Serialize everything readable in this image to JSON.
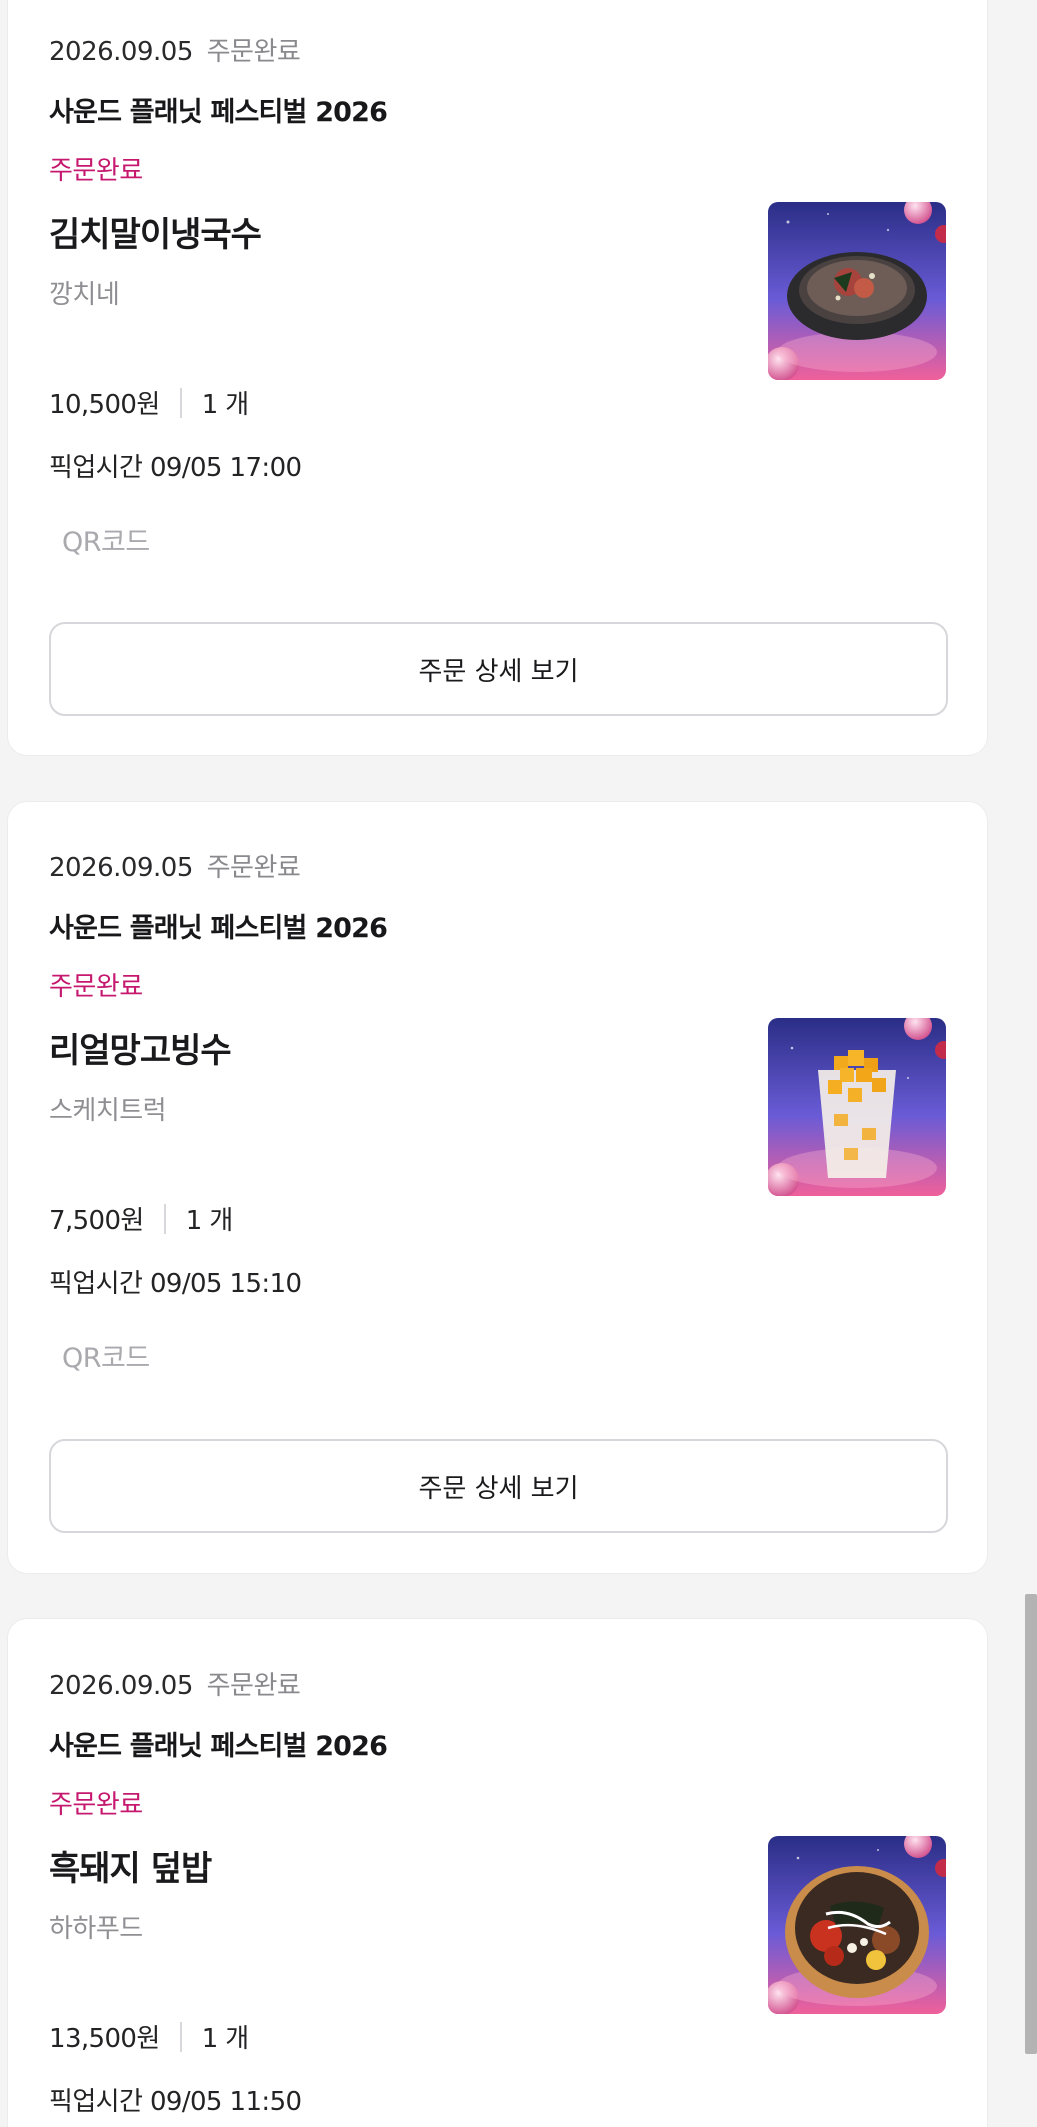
{
  "orders": [
    {
      "date": "2026.09.05",
      "date_status": "주문완료",
      "festival": "사운드 플래닛 페스티벌 2026",
      "status": "주문완료",
      "menu_name": "김치말이냉국수",
      "vendor": "깡치네",
      "price": "10,500원",
      "quantity": "1 개",
      "pickup": "픽업시간 09/05 17:00",
      "qr_label": "QR코드",
      "detail_button": "주문 상세 보기",
      "image_icon": "cold-noodle-bowl-image"
    },
    {
      "date": "2026.09.05",
      "date_status": "주문완료",
      "festival": "사운드 플래닛 페스티벌 2026",
      "status": "주문완료",
      "menu_name": "리얼망고빙수",
      "vendor": "스케치트럭",
      "price": "7,500원",
      "quantity": "1 개",
      "pickup": "픽업시간 09/05 15:10",
      "qr_label": "QR코드",
      "detail_button": "주문 상세 보기",
      "image_icon": "mango-bingsu-cup-image"
    },
    {
      "date": "2026.09.05",
      "date_status": "주문완료",
      "festival": "사운드 플래닛 페스티벌 2026",
      "status": "주문완료",
      "menu_name": "흑돼지 덮밥",
      "vendor": "하하푸드",
      "price": "13,500원",
      "quantity": "1 개",
      "pickup": "픽업시간 09/05 11:50",
      "image_icon": "pork-rice-bowl-image"
    }
  ],
  "colors": {
    "accent_pink": "#c5186e",
    "page_background": "#f4f4f5",
    "card_background": "#ffffff"
  }
}
